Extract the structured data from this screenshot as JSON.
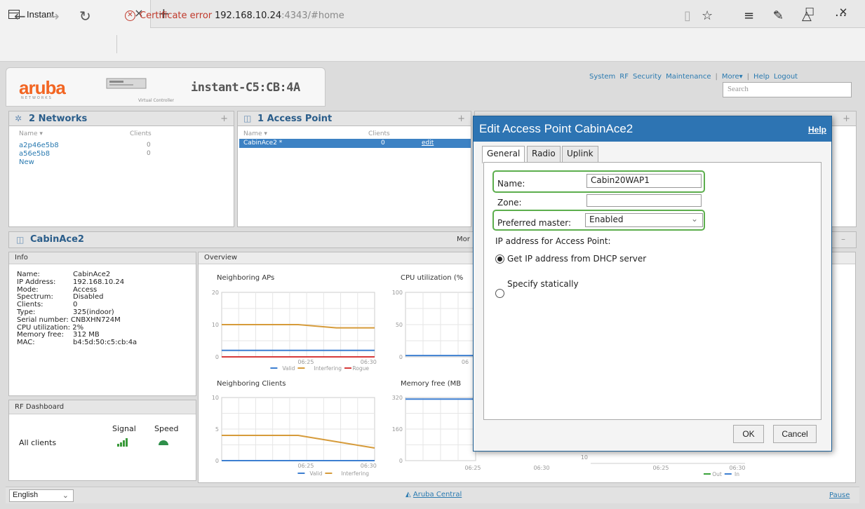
{
  "browser": {
    "tab_title": "Instant",
    "tab_close": "×",
    "new_tab": "+",
    "minimize": "–",
    "maximize": "☐",
    "close": "✕",
    "back": "←",
    "forward": "→",
    "refresh": "↻",
    "cert_error": "Certificate error",
    "url_host": "192.168.10.24",
    "url_rest": ":4343/#home",
    "reading": "▯",
    "favorite": "☆",
    "hub": "≡",
    "notes": "✎",
    "share": "△",
    "more": "···"
  },
  "app": {
    "logo": "aruba",
    "logo_sub": "NETWORKS",
    "vc_label": "Virtual Controller",
    "name": "instant-C5:CB:4A",
    "menu": [
      "System",
      "RF",
      "Security",
      "Maintenance",
      "|",
      "More▾",
      "|",
      "Help",
      "Logout"
    ],
    "search_placeholder": "Search"
  },
  "networks": {
    "title": "2 Networks",
    "col_name": "Name ▾",
    "col_clients": "Clients",
    "rows": [
      {
        "name": "a2p46e5b8",
        "clients": "0"
      },
      {
        "name": "a56e5b8",
        "clients": "0"
      }
    ],
    "new": "New",
    "plus": "+"
  },
  "aps": {
    "title": "1 Access Point",
    "col_name": "Name ▾",
    "col_clients": "Clients",
    "row": {
      "name": "CabinAce2 *",
      "clients": "0",
      "edit": "edit"
    },
    "plus": "+"
  },
  "third_panel": {
    "plus": "+",
    "minus": "–"
  },
  "ap_detail": {
    "title": "CabinAce2",
    "more": "Mor",
    "info_head": "Info",
    "info": [
      {
        "k": "Name:",
        "v": "CabinAce2"
      },
      {
        "k": "IP Address:",
        "v": "192.168.10.24"
      },
      {
        "k": "Mode:",
        "v": "Access"
      },
      {
        "k": "Spectrum:",
        "v": "Disabled"
      },
      {
        "k": "Clients:",
        "v": "0"
      },
      {
        "k": "Type:",
        "v": "325(indoor)"
      },
      {
        "k": "Serial number:",
        "v": "CNBXHN724M"
      },
      {
        "k": "CPU utilization:",
        "v": "2%"
      },
      {
        "k": "Memory free:",
        "v": "312 MB"
      },
      {
        "k": "MAC:",
        "v": "b4:5d:50:c5:cb:4a"
      }
    ],
    "rf_head": "RF Dashboard",
    "rf_signal": "Signal",
    "rf_speed": "Speed",
    "rf_all": "All clients"
  },
  "overview": {
    "title": "Overview",
    "charts": [
      {
        "title": "Neighboring APs",
        "yticks": [
          "20",
          "10",
          "0"
        ],
        "xticks": [
          "06:25",
          "06:30"
        ],
        "legend": [
          "Valid",
          "Interfering",
          "Rogue"
        ]
      },
      {
        "title": "CPU utilization  (%",
        "yticks": [
          "100",
          "50",
          "0"
        ],
        "xticks": [
          "06"
        ]
      },
      {
        "title": "Neighboring Clients",
        "yticks": [
          "10",
          "5",
          "0"
        ],
        "xticks": [
          "06:25",
          "06:30"
        ],
        "legend": [
          "Valid",
          "Interfering"
        ]
      },
      {
        "title": "Memory free  (MB",
        "yticks": [
          "320",
          "160",
          "0"
        ],
        "xticks": [
          "06:25",
          "06:30"
        ]
      },
      {
        "title": "",
        "yticks": [
          "10"
        ],
        "xticks": [
          "06:25",
          "06:30"
        ],
        "legend": [
          "Out",
          "In"
        ]
      }
    ]
  },
  "chart_data": [
    {
      "type": "line",
      "title": "Neighboring APs",
      "ylim": [
        0,
        20
      ],
      "x": [
        "06:20",
        "06:25",
        "06:27",
        "06:30",
        "06:31"
      ],
      "series": [
        {
          "name": "Valid",
          "values": [
            2,
            2,
            2,
            2,
            2
          ]
        },
        {
          "name": "Interfering",
          "values": [
            10,
            10,
            10,
            9,
            9
          ]
        },
        {
          "name": "Rogue",
          "values": [
            0,
            0,
            0,
            0,
            0
          ]
        }
      ]
    },
    {
      "type": "line",
      "title": "CPU utilization  (%",
      "ylim": [
        0,
        100
      ],
      "x": [
        "06:20",
        "06:25"
      ],
      "series": [
        {
          "values": [
            2,
            2
          ]
        }
      ]
    },
    {
      "type": "line",
      "title": "Neighboring Clients",
      "ylim": [
        0,
        10
      ],
      "x": [
        "06:20",
        "06:25",
        "06:27",
        "06:30",
        "06:31"
      ],
      "series": [
        {
          "name": "Valid",
          "values": [
            0,
            0,
            0,
            0,
            0
          ]
        },
        {
          "name": "Interfering",
          "values": [
            4,
            4,
            4,
            3,
            2
          ]
        }
      ]
    },
    {
      "type": "line",
      "title": "Memory free  (MB",
      "ylim": [
        0,
        320
      ],
      "x": [
        "06:20",
        "06:25"
      ],
      "series": [
        {
          "values": [
            312,
            312
          ]
        }
      ]
    }
  ],
  "dialog": {
    "title": "Edit Access Point CabinAce2",
    "help": "Help",
    "tabs": [
      "General",
      "Radio",
      "Uplink"
    ],
    "name_label": "Name:",
    "name_value": "Cabin20WAP1",
    "zone_label": "Zone:",
    "zone_value": "",
    "pref_label": "Preferred master:",
    "pref_value": "Enabled",
    "ip_label": "IP address for Access Point:",
    "opt_dhcp": "Get IP address from DHCP server",
    "opt_static": "Specify statically",
    "ok": "OK",
    "cancel": "Cancel"
  },
  "footer": {
    "language": "English",
    "central": "Aruba Central",
    "pause": "Pause"
  }
}
